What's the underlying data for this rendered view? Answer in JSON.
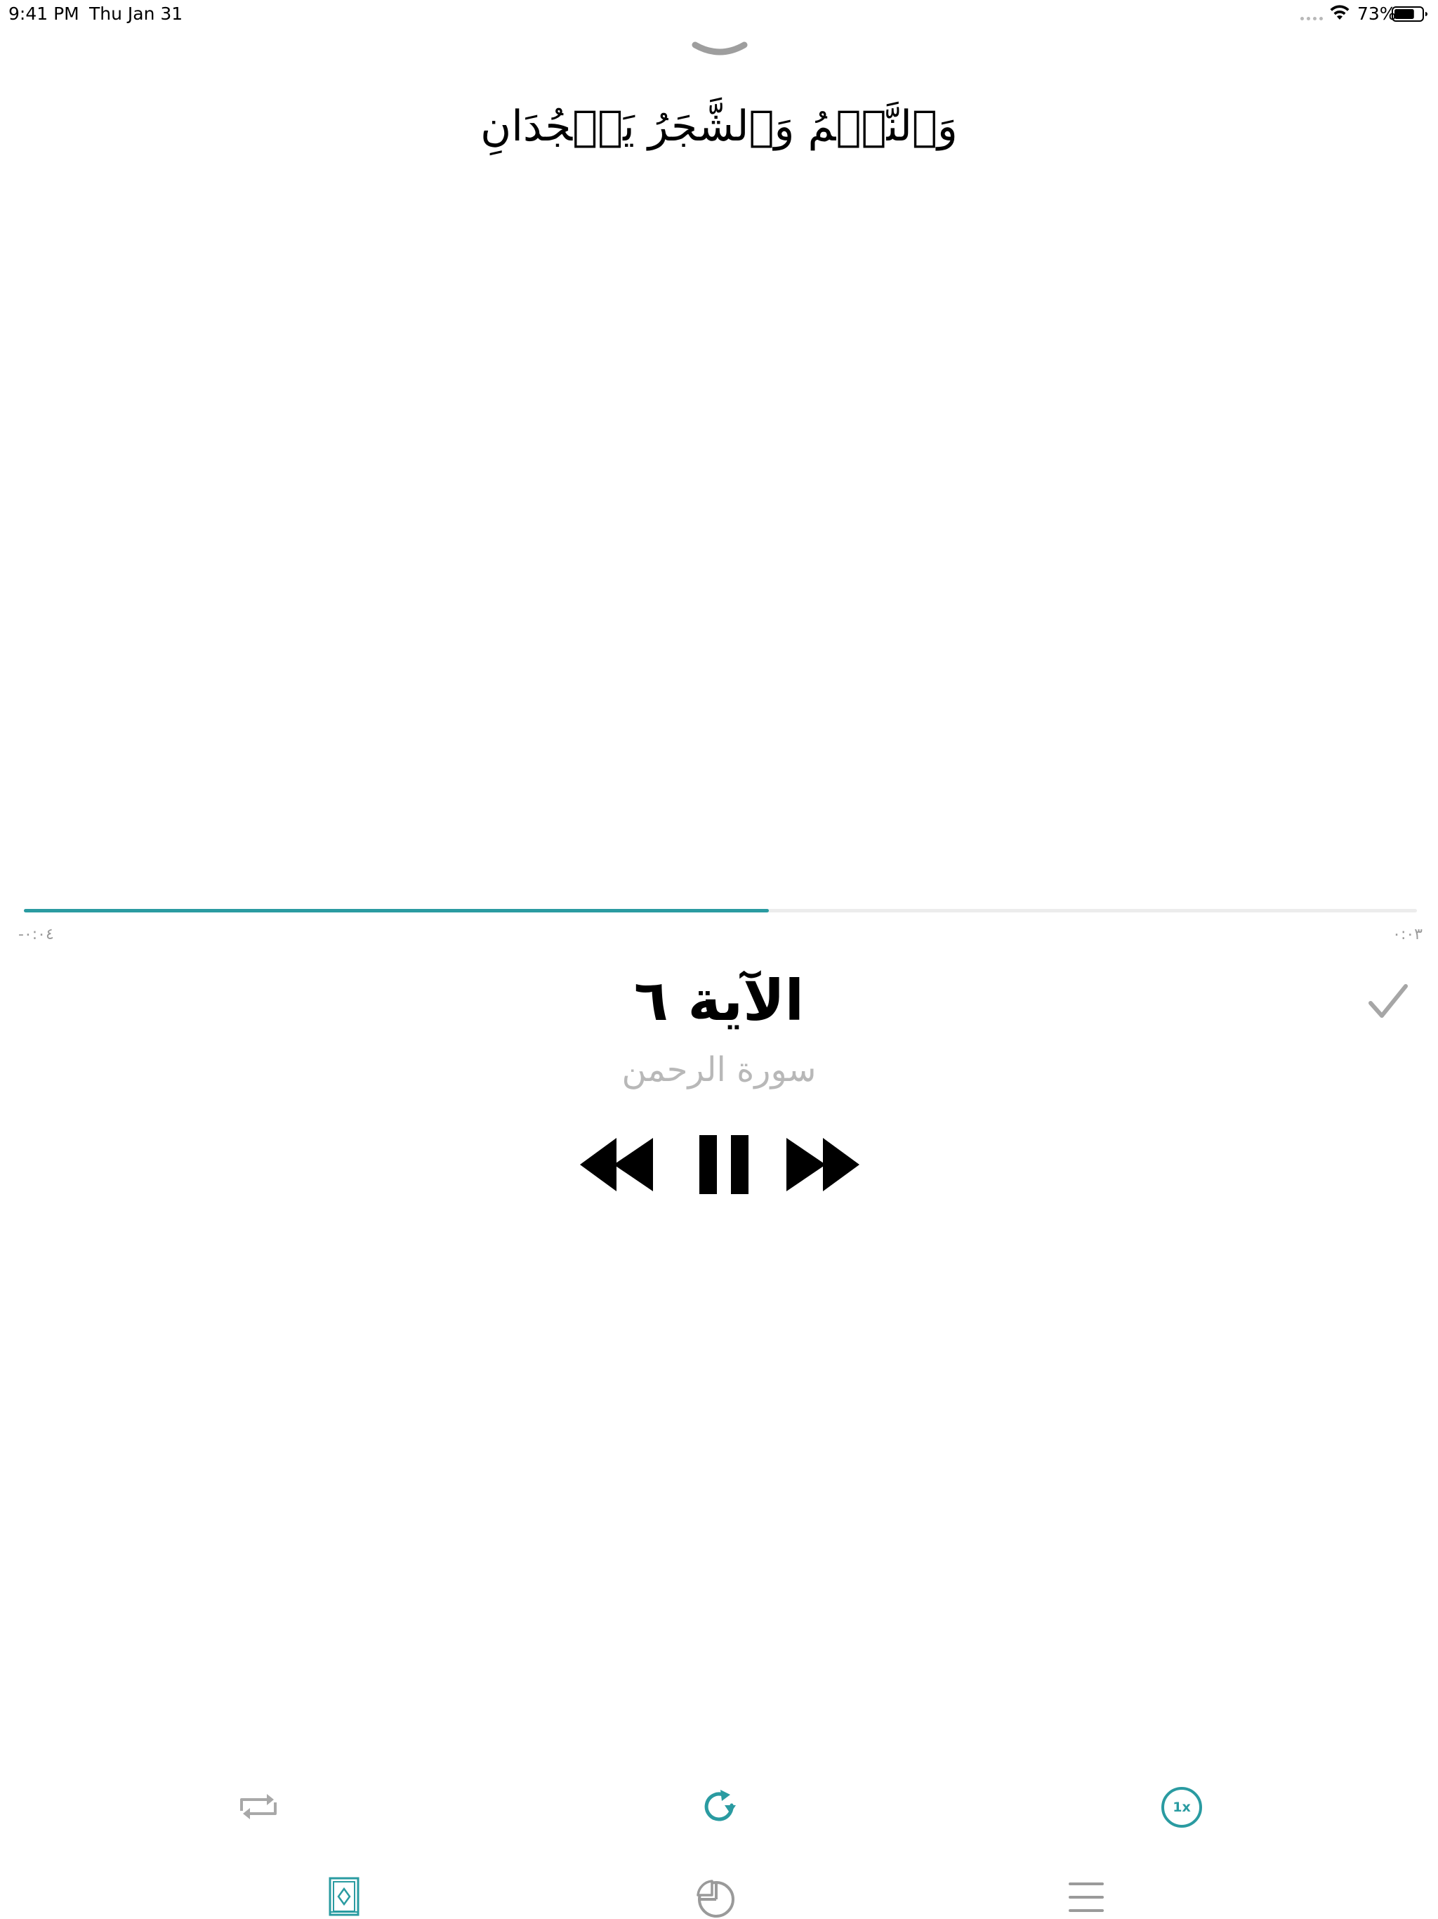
{
  "status_bar": {
    "time": "9:41 PM",
    "date": "Thu Jan 31",
    "battery_percent": "73%",
    "battery_level": 0.73,
    "icons": [
      "signal-dots-icon",
      "wifi-icon",
      "battery-icon"
    ]
  },
  "verse": {
    "text": "وَٱلنَّجۡمُ وَٱلشَّجَرُ يَسۡجُدَانِ"
  },
  "player": {
    "progress": 0.535,
    "time_left": "-٠:٠٤",
    "time_right": "٠:٠٣",
    "ayah_title": "الآية ٦",
    "surah_name": "سورة الرحمن",
    "speed_label": "1x",
    "controls": [
      "rewind-icon",
      "pause-icon",
      "fast-forward-icon"
    ],
    "secondary_controls": [
      "repeat-icon",
      "reload-icon",
      "speed-icon"
    ]
  },
  "tab_bar": {
    "tabs": [
      {
        "icon": "quran-book-icon",
        "active": true
      },
      {
        "icon": "stats-pie-icon",
        "active": false
      },
      {
        "icon": "menu-icon",
        "active": false
      }
    ]
  },
  "colors": {
    "accent": "#2a9ba1",
    "muted": "#b8b8b8",
    "text": "#000000",
    "track": "#ececec"
  }
}
